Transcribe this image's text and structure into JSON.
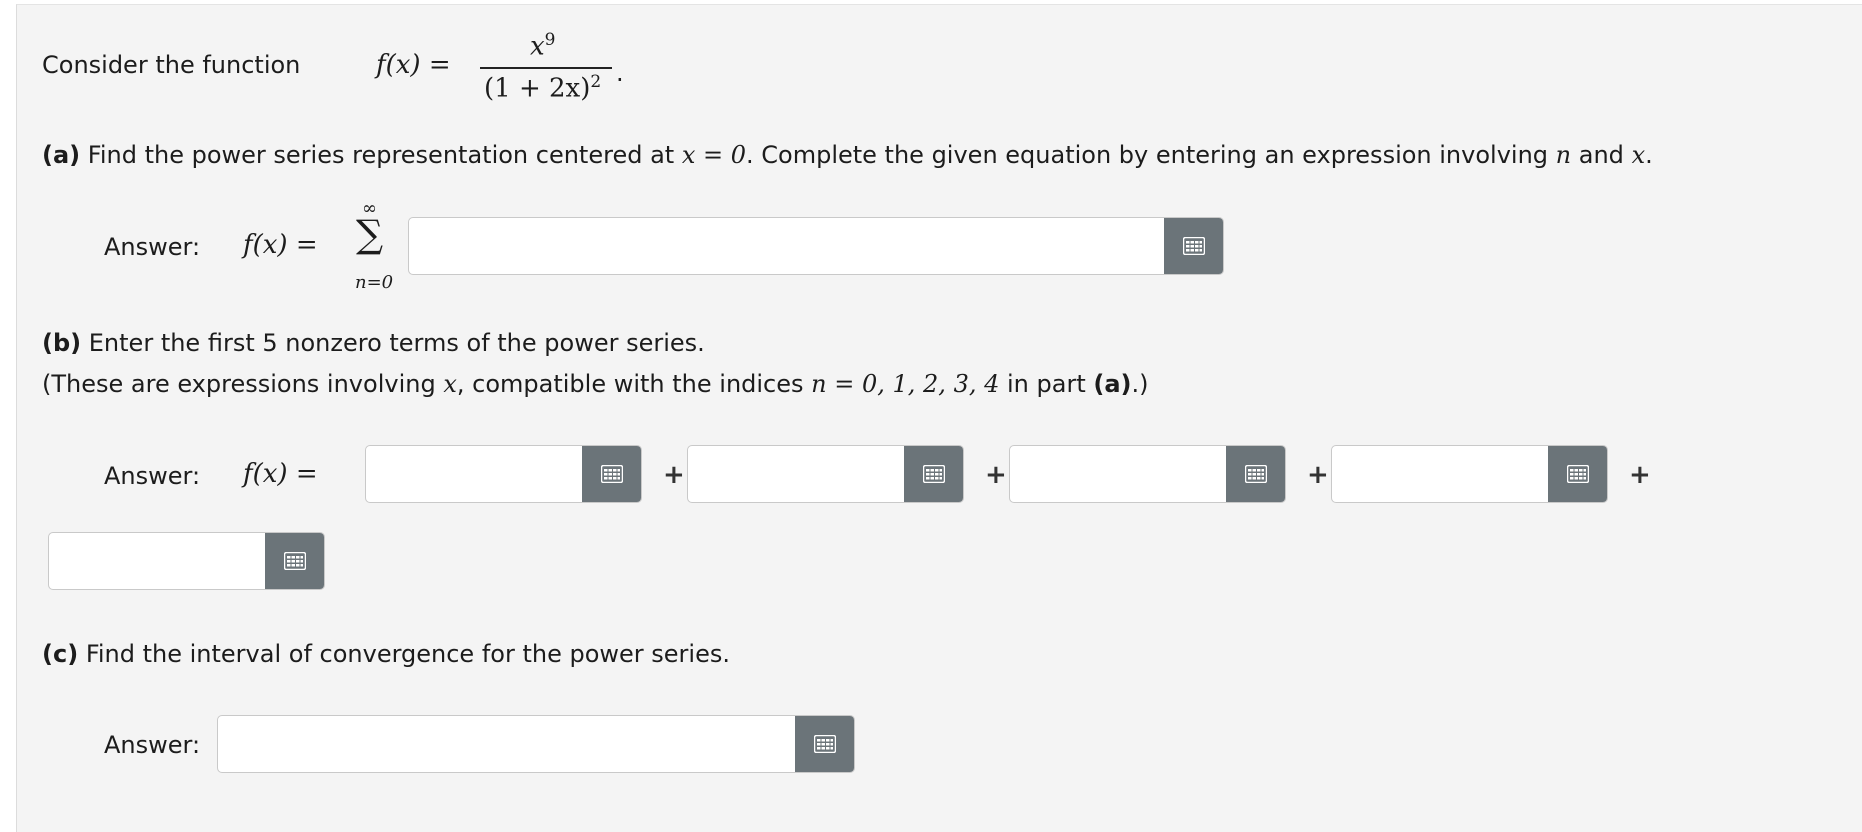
{
  "intro": {
    "text": "Consider the function",
    "lhs": "f(x) =",
    "numerator_base": "x",
    "numerator_exp": "9",
    "denominator": "(1 + 2x)",
    "denominator_exp": "2",
    "period": "."
  },
  "part_a": {
    "label": "(a)",
    "text1": "Find the power series representation centered at",
    "math1": "x = 0",
    "text2": ". Complete the given equation by entering an expression involving",
    "var_n": "n",
    "and": "and",
    "var_x": "x",
    "period": ".",
    "answer_label": "Answer:",
    "lhs": "f(x) =",
    "sum_upper": "∞",
    "sum_symbol": "∑",
    "sum_lower": "n=0",
    "input_value": ""
  },
  "part_b": {
    "label": "(b)",
    "text1": "Enter the first 5 nonzero terms of the power series.",
    "text2a": "(These are expressions involving",
    "var_x": "x",
    "text2b": ", compatible with the indices",
    "indices": "n = 0, 1, 2, 3, 4",
    "text2c": "in part",
    "part_ref": "(a)",
    "text2d": ".)",
    "answer_label": "Answer:",
    "lhs": "f(x) =",
    "plus": "+",
    "inputs": [
      "",
      "",
      "",
      "",
      ""
    ]
  },
  "part_c": {
    "label": "(c)",
    "text": "Find the interval of convergence for the power series.",
    "answer_label": "Answer:",
    "input_value": ""
  },
  "icons": {
    "keyboard_button": "keypad-grid-icon",
    "button_color": "#6b7479"
  }
}
